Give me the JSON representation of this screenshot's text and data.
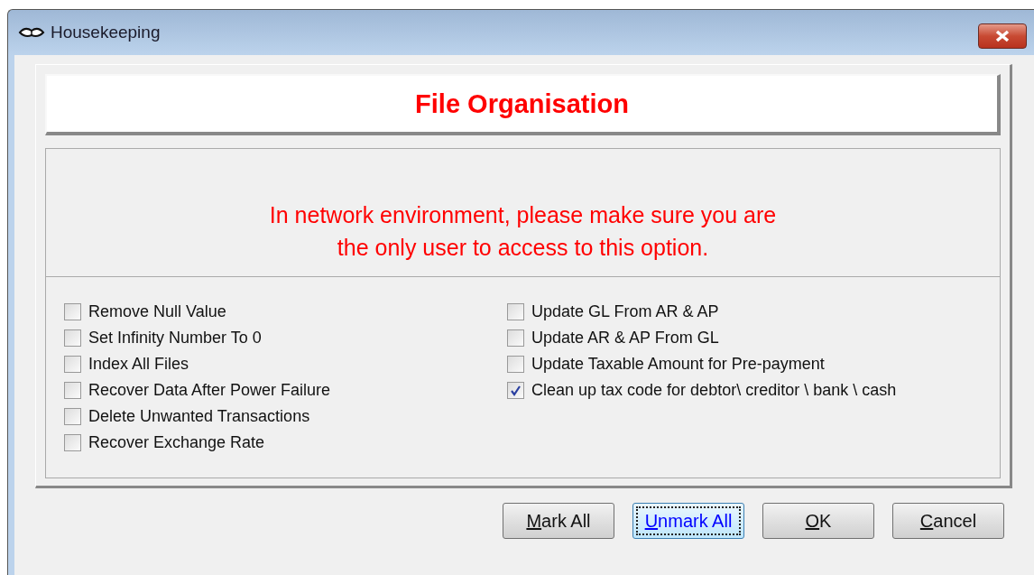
{
  "window": {
    "title": "Housekeeping"
  },
  "header": {
    "title": "File Organisation"
  },
  "warning": [
    "In network environment, please make sure you are",
    "the only user to access to this option."
  ],
  "options_left": [
    {
      "label": "Remove Null Value",
      "checked": false
    },
    {
      "label": "Set Infinity Number To 0",
      "checked": false
    },
    {
      "label": "Index All Files",
      "checked": false
    },
    {
      "label": "Recover Data After Power Failure",
      "checked": false
    },
    {
      "label": "Delete Unwanted Transactions",
      "checked": false
    },
    {
      "label": "Recover Exchange Rate",
      "checked": false
    }
  ],
  "options_right": [
    {
      "label": "Update GL From AR & AP",
      "checked": false
    },
    {
      "label": "Update AR & AP From GL",
      "checked": false
    },
    {
      "label": "Update Taxable Amount for Pre-payment",
      "checked": false
    },
    {
      "label": "Clean up tax code for debtor\\ creditor \\ bank \\ cash",
      "checked": true
    }
  ],
  "buttons": [
    {
      "label": "Mark All",
      "focused": false
    },
    {
      "label": "Unmark All",
      "focused": true
    },
    {
      "label": "OK",
      "focused": false
    },
    {
      "label": "Cancel",
      "focused": false
    }
  ]
}
